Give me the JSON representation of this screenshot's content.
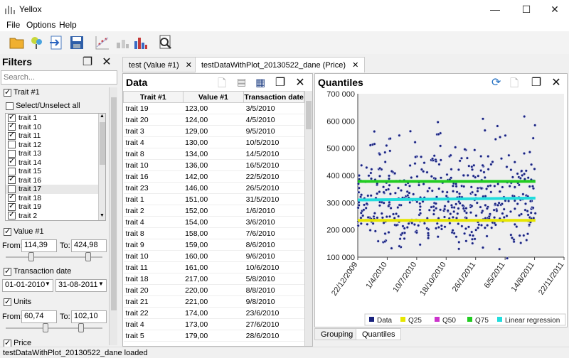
{
  "window": {
    "title": "Yellox",
    "minimize": "—",
    "maximize": "☐",
    "close": "✕"
  },
  "menu": [
    "File",
    "Options",
    "Help"
  ],
  "filters": {
    "title": "Filters",
    "search_placeholder": "Search...",
    "trait": {
      "label": "Trait #1",
      "select_all": "Select/Unselect all",
      "items": [
        {
          "label": "trait 1",
          "checked": true
        },
        {
          "label": "trait 10",
          "checked": true
        },
        {
          "label": "trait 11",
          "checked": true
        },
        {
          "label": "trait 12",
          "checked": false
        },
        {
          "label": "trait 13",
          "checked": false
        },
        {
          "label": "trait 14",
          "checked": true
        },
        {
          "label": "trait 15",
          "checked": false
        },
        {
          "label": "trait 16",
          "checked": true
        },
        {
          "label": "trait 17",
          "checked": false
        },
        {
          "label": "trait 18",
          "checked": true
        },
        {
          "label": "trait 19",
          "checked": true
        },
        {
          "label": "trait 2",
          "checked": true
        }
      ]
    },
    "value": {
      "label": "Value #1",
      "from_label": "From:",
      "from": "114,39",
      "to_label": "To:",
      "to": "424,98"
    },
    "transaction_date": {
      "label": "Transaction date",
      "from": "01-01-2010",
      "to": "31-08-2011"
    },
    "units": {
      "label": "Units",
      "from_label": "From:",
      "from": "60,74",
      "to_label": "To:",
      "to": "102,10"
    },
    "price": {
      "label": "Price"
    }
  },
  "tabs": [
    {
      "label": "test (Value #1)",
      "active": false
    },
    {
      "label": "testDataWithPlot_20130522_dane (Price)",
      "active": true
    }
  ],
  "data_panel": {
    "title": "Data",
    "columns": [
      "Trait #1",
      "Value #1",
      "Transaction date"
    ],
    "rows": [
      [
        "trait 19",
        "123,00",
        "3/5/2010"
      ],
      [
        "trait 20",
        "124,00",
        "4/5/2010"
      ],
      [
        "trait 3",
        "129,00",
        "9/5/2010"
      ],
      [
        "trait 4",
        "130,00",
        "10/5/2010"
      ],
      [
        "trait 8",
        "134,00",
        "14/5/2010"
      ],
      [
        "trait 10",
        "136,00",
        "16/5/2010"
      ],
      [
        "trait 16",
        "142,00",
        "22/5/2010"
      ],
      [
        "trait 23",
        "146,00",
        "26/5/2010"
      ],
      [
        "trait 1",
        "151,00",
        "31/5/2010"
      ],
      [
        "trait 2",
        "152,00",
        "1/6/2010"
      ],
      [
        "trait 4",
        "154,00",
        "3/6/2010"
      ],
      [
        "trait 8",
        "158,00",
        "7/6/2010"
      ],
      [
        "trait 9",
        "159,00",
        "8/6/2010"
      ],
      [
        "trait 10",
        "160,00",
        "9/6/2010"
      ],
      [
        "trait 11",
        "161,00",
        "10/6/2010"
      ],
      [
        "trait 18",
        "217,00",
        "5/8/2010"
      ],
      [
        "trait 20",
        "220,00",
        "8/8/2010"
      ],
      [
        "trait 21",
        "221,00",
        "9/8/2010"
      ],
      [
        "trait 22",
        "174,00",
        "23/6/2010"
      ],
      [
        "trait 4",
        "173,00",
        "27/6/2010"
      ],
      [
        "trait 5",
        "179,00",
        "28/6/2010"
      ]
    ]
  },
  "quantiles_panel": {
    "title": "Quantiles",
    "y_ticks": [
      "700 000",
      "600 000",
      "500 000",
      "400 000",
      "300 000",
      "200 000",
      "100 000"
    ],
    "x_ticks": [
      "22/12/2009",
      "1/4/2010",
      "10/7/2010",
      "18/10/2010",
      "26/1/2011",
      "6/5/2011",
      "14/8/2011",
      "22/11/2011"
    ],
    "legend": [
      "Data",
      "Q25",
      "Q50",
      "Q75",
      "Linear regression"
    ],
    "colors": {
      "data": "#1a237e",
      "q25": "#e6e600",
      "q50": "#cc33cc",
      "q75": "#22cc22",
      "linreg": "#22dddd"
    },
    "bottom_tabs": [
      {
        "label": "Grouping",
        "active": false
      },
      {
        "label": "Quantiles",
        "active": true
      }
    ]
  },
  "chart_data": {
    "type": "scatter",
    "title": "",
    "xlabel": "",
    "ylabel": "",
    "ylim": [
      100000,
      700000
    ],
    "xlim": [
      "22/12/2009",
      "22/11/2011"
    ],
    "x_range_data": [
      "22/12/2009",
      "17/8/2011"
    ],
    "y_range_data": [
      80000,
      650000
    ],
    "q25": 235000,
    "q75": 378000,
    "linear_regression": [
      310000,
      317000
    ],
    "legend_position": "bottom"
  },
  "status": "testDataWithPlot_20130522_dane loaded"
}
